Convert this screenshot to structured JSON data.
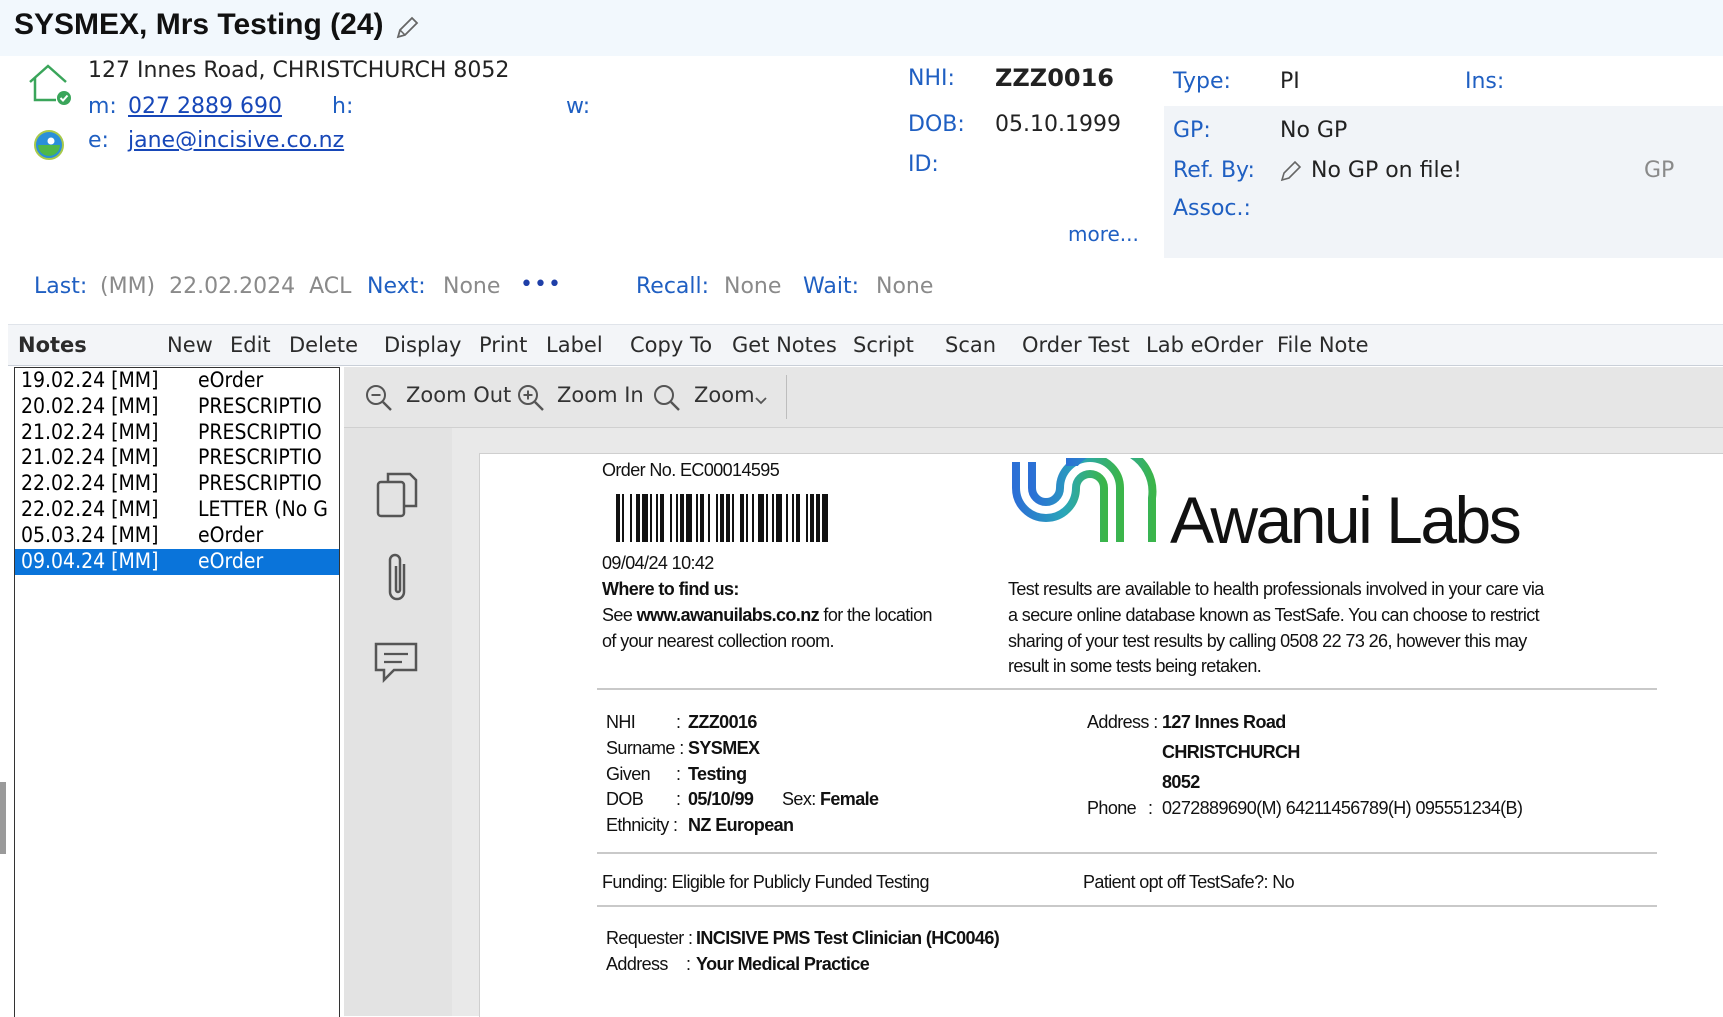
{
  "patient": {
    "title": "SYSMEX, Mrs Testing (24)",
    "address": "127 Innes Road, CHRISTCHURCH 8052",
    "mobile_label": "m:",
    "mobile": "027 2889 690",
    "home_label": "h:",
    "work_label": "w:",
    "email_label": "e:",
    "email": "jane@incisive.co.nz",
    "nhi_label": "NHI:",
    "nhi": "ZZZ0016",
    "dob_label": "DOB:",
    "dob": "05.10.1999",
    "id_label": "ID:",
    "more_link": "more...",
    "type_label": "Type:",
    "type": "PI",
    "ins_label": "Ins:",
    "gp_label": "GP:",
    "gp": "No GP",
    "refby_label": "Ref. By:",
    "refby": "No GP on file!",
    "refby_right": "GP",
    "assoc_label": "Assoc.:"
  },
  "appointments": {
    "last_label": "Last:",
    "last_value": "(MM)  22.02.2024  ACL",
    "next_label": "Next:",
    "next_value": "None",
    "more_dots": "•••",
    "recall_label": "Recall:",
    "recall_value": "None",
    "wait_label": "Wait:",
    "wait_value": "None"
  },
  "toolbar": {
    "notes": "Notes",
    "new": "New",
    "edit": "Edit",
    "delete": "Delete",
    "display": "Display",
    "print": "Print",
    "label": "Label",
    "copy_to": "Copy To",
    "get_notes": "Get Notes",
    "script": "Script",
    "scan": "Scan",
    "order_test": "Order Test",
    "lab_eorder": "Lab eOrder",
    "file_note": "File Note"
  },
  "notes": [
    {
      "date": "19.02.24 [MM]",
      "type": "eOrder",
      "selected": false
    },
    {
      "date": "20.02.24 [MM]",
      "type": "PRESCRIPTIO",
      "selected": false
    },
    {
      "date": "21.02.24 [MM]",
      "type": "PRESCRIPTIO",
      "selected": false
    },
    {
      "date": "21.02.24 [MM]",
      "type": "PRESCRIPTIO",
      "selected": false
    },
    {
      "date": "22.02.24 [MM]",
      "type": "PRESCRIPTIO",
      "selected": false
    },
    {
      "date": "22.02.24 [MM]",
      "type": "LETTER (No G",
      "selected": false
    },
    {
      "date": "05.03.24 [MM]",
      "type": "eOrder",
      "selected": false
    },
    {
      "date": "09.04.24 [MM]",
      "type": "eOrder",
      "selected": true
    }
  ],
  "viewer": {
    "zoom_out": "Zoom Out",
    "zoom_in": "Zoom In",
    "zoom": "Zoom"
  },
  "document": {
    "order_no": "Order No. EC00014595",
    "datetime": "09/04/24 10:42",
    "where_heading": "Where to find us:",
    "where_line1_pre": "See ",
    "where_url": "www.awanuilabs.co.nz",
    "where_line1_post": " for the location",
    "where_line2": "of your nearest collection room.",
    "brand": "Awanui Labs",
    "testsafe_1": "Test results are available to health professionals involved in your care via",
    "testsafe_2": "a secure online database known as TestSafe. You can choose to restrict",
    "testsafe_3": "sharing of your test results by calling 0508 22 73 26, however this may",
    "testsafe_4": "result in some tests being retaken.",
    "nhi_label": "NHI",
    "nhi_value": "ZZZ0016",
    "surname_label": "Surname :",
    "surname_value": "SYSMEX",
    "given_label": "Given",
    "given_value": "Testing",
    "dob_label": "DOB",
    "dob_value": "05/10/99",
    "sex_label": "Sex:",
    "sex_value": "Female",
    "ethnicity_label": "Ethnicity :",
    "ethnicity_value": "NZ European",
    "address_label": "Address :",
    "address_1": "127 Innes Road",
    "address_2": "CHRISTCHURCH",
    "address_3": "8052",
    "phone_label": "Phone",
    "phone_value": "0272889690(M) 64211456789(H) 095551234(B)",
    "funding": "Funding: Eligible for Publicly Funded Testing",
    "optoff": "Patient opt off TestSafe?: No",
    "requester_label": "Requester :",
    "requester_value": "INCISIVE PMS Test Clinician (HC0046)",
    "req_address_label": "Address",
    "req_address_value": "Your Medical Practice"
  },
  "colors": {
    "label_blue": "#1f5fc2",
    "selection": "#0a74da",
    "brand_blue": "#2b6fd6",
    "brand_green": "#3bb54a"
  }
}
